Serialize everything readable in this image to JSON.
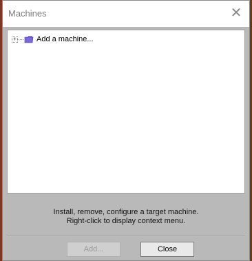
{
  "window": {
    "title": "Machines",
    "close_glyph": "✕"
  },
  "tree": {
    "items": [
      {
        "expander": "+",
        "icon": "folder-icon",
        "label": "Add a machine..."
      }
    ]
  },
  "info": {
    "line1": "Install, remove, configure a target machine.",
    "line2": "Right-click to display context menu."
  },
  "buttons": {
    "add_label": "Add...",
    "add_enabled": false,
    "close_label": "Close"
  },
  "colors": {
    "panel": "#b9b9b9",
    "titlebar": "#ffffff",
    "title_text": "#7d7d7d",
    "disabled_text": "#9a9a9a",
    "folder": "#7b68d8"
  }
}
